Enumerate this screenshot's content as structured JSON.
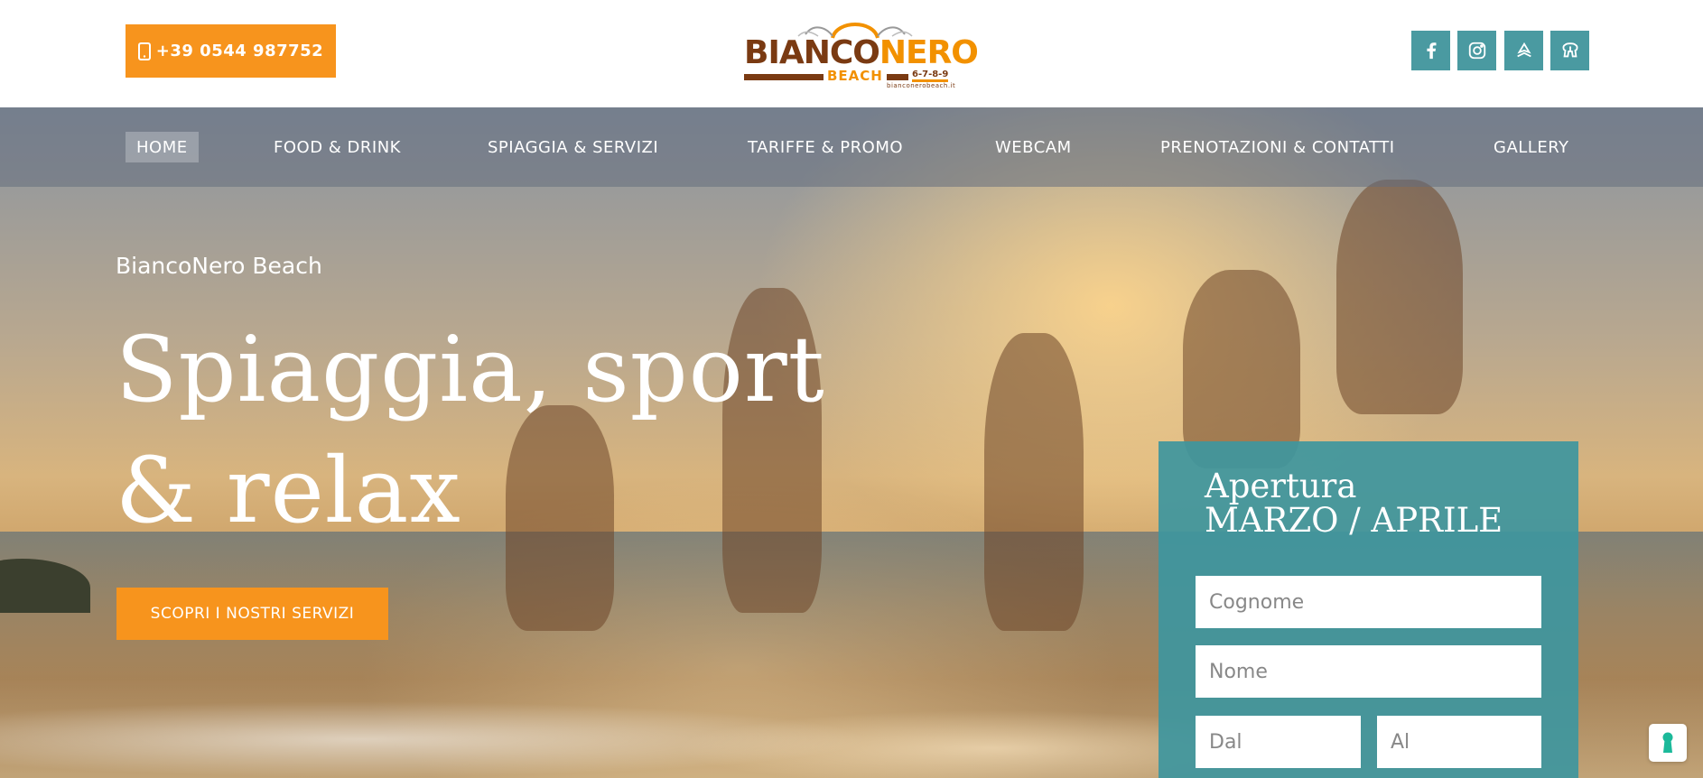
{
  "header": {
    "phone": "+39 0544 987752",
    "logo": {
      "part1": "BIANCO",
      "part2": "NERO",
      "sub": "BEACH",
      "numbers": "6-7-8-9",
      "url": "bianconerobeach.it"
    },
    "social": [
      {
        "icon": "facebook-icon"
      },
      {
        "icon": "instagram-icon"
      },
      {
        "icon": "tripadvisor-icon"
      },
      {
        "icon": "map-icon"
      }
    ]
  },
  "nav": {
    "items": [
      {
        "label": "HOME",
        "active": true
      },
      {
        "label": "FOOD & DRINK"
      },
      {
        "label": "SPIAGGIA & SERVIZI"
      },
      {
        "label": "TARIFFE & PROMO"
      },
      {
        "label": "WEBCAM"
      },
      {
        "label": "PRENOTAZIONI & CONTATTI"
      },
      {
        "label": "GALLERY"
      }
    ]
  },
  "hero": {
    "eyebrow": "BiancoNero Beach",
    "headline": "Spiaggia, sport & relax",
    "cta": "SCOPRI I NOSTRI SERVIZI"
  },
  "booking": {
    "title_line1": "Apertura",
    "title_line2": "MARZO / APRILE",
    "fields": {
      "surname_placeholder": "Cognome",
      "name_placeholder": "Nome",
      "from_placeholder": "Dal",
      "to_placeholder": "Al"
    }
  },
  "colors": {
    "accent": "#f7941d",
    "teal": "#4a9aa1",
    "logo_brown": "#7a3a12",
    "logo_orange": "#f29100"
  }
}
